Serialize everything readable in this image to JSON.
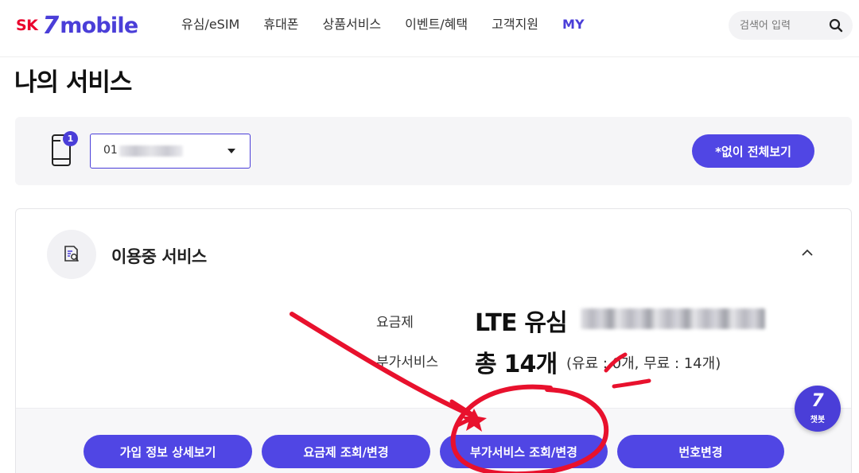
{
  "header": {
    "logo": {
      "brand_sk": "SK",
      "brand_seven": "7",
      "brand_mobile": "mobile"
    },
    "nav": [
      {
        "label": "유심/eSIM"
      },
      {
        "label": "휴대폰"
      },
      {
        "label": "상품서비스"
      },
      {
        "label": "이벤트/혜택"
      },
      {
        "label": "고객지원"
      },
      {
        "label": "MY",
        "active": true
      }
    ],
    "search": {
      "placeholder": "검색어 입력",
      "icon": "search-icon"
    }
  },
  "page": {
    "title": "나의 서비스"
  },
  "phone_bar": {
    "badge_count": "1",
    "selected_number_prefix": "01",
    "view_all_label": "*없이 전체보기"
  },
  "service_card": {
    "title": "이용중 서비스",
    "plan_label": "요금제",
    "plan_value": "LTE 유심",
    "addon_label": "부가서비스",
    "addon_total": "총 14개",
    "addon_detail": "(유료 : 0개, 무료 : 14개)",
    "buttons": [
      {
        "label": "가입 정보 상세보기"
      },
      {
        "label": "요금제 조회/변경"
      },
      {
        "label": "부가서비스 조회/변경"
      },
      {
        "label": "번호변경"
      }
    ]
  },
  "chatbot": {
    "label": "챗봇"
  },
  "colors": {
    "accent": "#5046e4",
    "brand_red": "#ea002c",
    "annotation": "#e8112d"
  }
}
